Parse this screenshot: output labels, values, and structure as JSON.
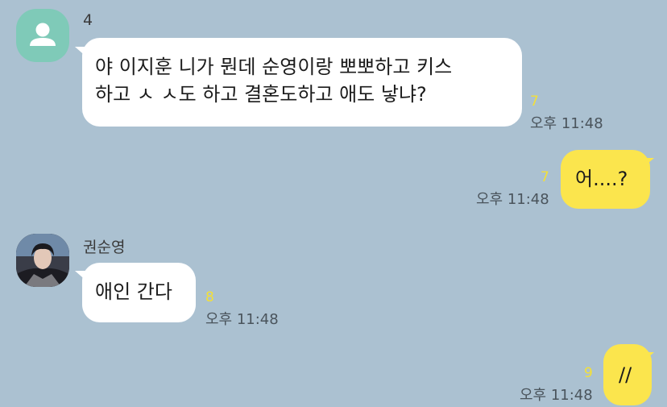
{
  "chat": {
    "messages": [
      {
        "sender": "4",
        "lines": [
          "야 이지훈 니가 뭔데 순영이랑 뽀뽀하고 키스",
          "하고 ㅅ ㅅ도 하고 결혼도하고 애도 낳냐?"
        ],
        "unread": "7",
        "time": "오후 11:48"
      },
      {
        "text": "어....?",
        "unread": "7",
        "time": "오후 11:48"
      },
      {
        "sender": "권순영",
        "text": "애인 간다",
        "unread": "8",
        "time": "오후 11:48"
      },
      {
        "text": "//",
        "unread": "9",
        "time": "오후 11:48"
      }
    ]
  },
  "colors": {
    "background": "#abc1d1",
    "incoming_bubble": "#ffffff",
    "outgoing_bubble": "#fbe54d",
    "unread_count": "#f4e036",
    "default_avatar": "#7fcab8"
  },
  "icons": {
    "default_avatar": "default-person-icon",
    "profile_photo": "profile-photo"
  }
}
